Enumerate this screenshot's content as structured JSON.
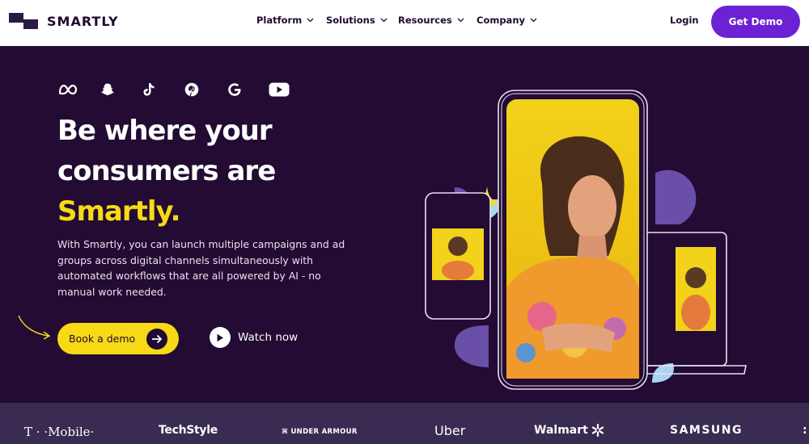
{
  "brand": {
    "name": "SMARTLY"
  },
  "nav": {
    "menu": [
      {
        "label": "Platform"
      },
      {
        "label": "Solutions"
      },
      {
        "label": "Resources"
      },
      {
        "label": "Company"
      }
    ],
    "login": "Login",
    "cta": "Get Demo"
  },
  "hero": {
    "social_icons": [
      "meta-icon",
      "snapchat-icon",
      "tiktok-icon",
      "pinterest-icon",
      "google-icon",
      "youtube-icon"
    ],
    "headline_line1": "Be where your",
    "headline_line2": "consumers are",
    "headline_accent": "Smartly.",
    "description": "With Smartly, you can launch multiple campaigns and ad groups across digital channels simultaneously with automated workflows that are all powered by AI - no manual work needed.",
    "primary_button": "Book a demo",
    "secondary_button": "Watch now"
  },
  "logos": [
    {
      "name": "T-Mobile",
      "text": "T · ·Mobile·"
    },
    {
      "name": "TechStyle",
      "text": "TechStyle"
    },
    {
      "name": "Under Armour",
      "text": "UNDER ARMOUR"
    },
    {
      "name": "Uber",
      "text": "Uber"
    },
    {
      "name": "Walmart",
      "text": "Walmart"
    },
    {
      "name": "Samsung",
      "text": "SAMSUNG"
    }
  ],
  "colors": {
    "brand_purple": "#6c22d4",
    "hero_bg": "#230b33",
    "accent_yellow": "#f7d916",
    "logo_bar": "#3a2b52",
    "shape_purple": "#6a4fa8",
    "shape_blue": "#a9d5f3"
  }
}
